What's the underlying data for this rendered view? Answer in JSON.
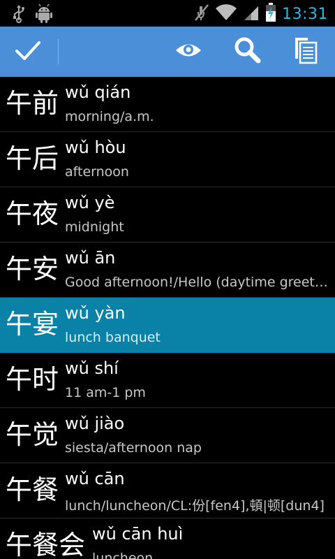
{
  "status_bar": {
    "time": "13:31",
    "left_icons": [
      "usb-icon",
      "android-debug-icon"
    ],
    "right_icons": [
      "mute-icon",
      "wifi-icon",
      "signal-icon",
      "battery-charging-icon"
    ]
  },
  "action_bar": {
    "color": "#4a8fd8",
    "actions": [
      "check-icon",
      "eye-icon",
      "search-icon",
      "copy-icon"
    ]
  },
  "list": {
    "selected_index": 4,
    "selected_color": "#0a82a8",
    "items": [
      {
        "hanzi": "午前",
        "pinyin": "wǔ qián",
        "gloss": "morning/a.m."
      },
      {
        "hanzi": "午后",
        "pinyin": "wǔ hòu",
        "gloss": "afternoon"
      },
      {
        "hanzi": "午夜",
        "pinyin": "wǔ yè",
        "gloss": "midnight"
      },
      {
        "hanzi": "午安",
        "pinyin": "wǔ ān",
        "gloss": "Good afternoon!/Hello (daytime greeting)"
      },
      {
        "hanzi": "午宴",
        "pinyin": "wǔ yàn",
        "gloss": "lunch banquet"
      },
      {
        "hanzi": "午时",
        "pinyin": "wǔ shí",
        "gloss": "11 am-1 pm"
      },
      {
        "hanzi": "午觉",
        "pinyin": "wǔ jiào",
        "gloss": "siesta/afternoon nap"
      },
      {
        "hanzi": "午餐",
        "pinyin": "wǔ cān",
        "gloss": "lunch/luncheon/CL:份[fen4],頓|顿[dun4]"
      },
      {
        "hanzi": "午餐会",
        "pinyin": "wǔ cān huì",
        "gloss": "luncheon"
      }
    ]
  }
}
